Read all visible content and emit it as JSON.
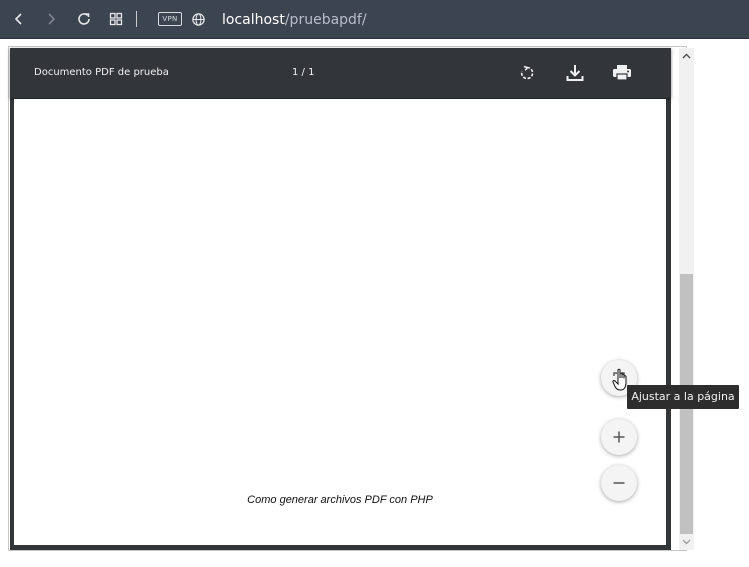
{
  "browser": {
    "back_icon": "chevron-left-icon",
    "forward_icon": "chevron-right-icon",
    "reload_icon": "reload-icon",
    "tabs_icon": "grid-icon",
    "vpn_label": "VPN",
    "globe_icon": "globe-icon",
    "url_host": "localhost",
    "url_path": "/pruebapdf/"
  },
  "viewer": {
    "title": "Documento PDF de prueba",
    "page_counter": "1 / 1",
    "rotate_icon": "rotate-icon",
    "download_icon": "download-icon",
    "print_icon": "print-icon"
  },
  "page": {
    "footer_text": "Como generar archivos PDF con PHP"
  },
  "zoom": {
    "fit_icon": "fit-page-icon",
    "zoom_in_icon": "plus-icon",
    "zoom_out_icon": "minus-icon",
    "tooltip": "Ajustar a la página"
  },
  "colors": {
    "browser_bar": "#3c4450",
    "viewer_toolbar": "#323639",
    "tooltip_bg": "#2d2d2d"
  }
}
